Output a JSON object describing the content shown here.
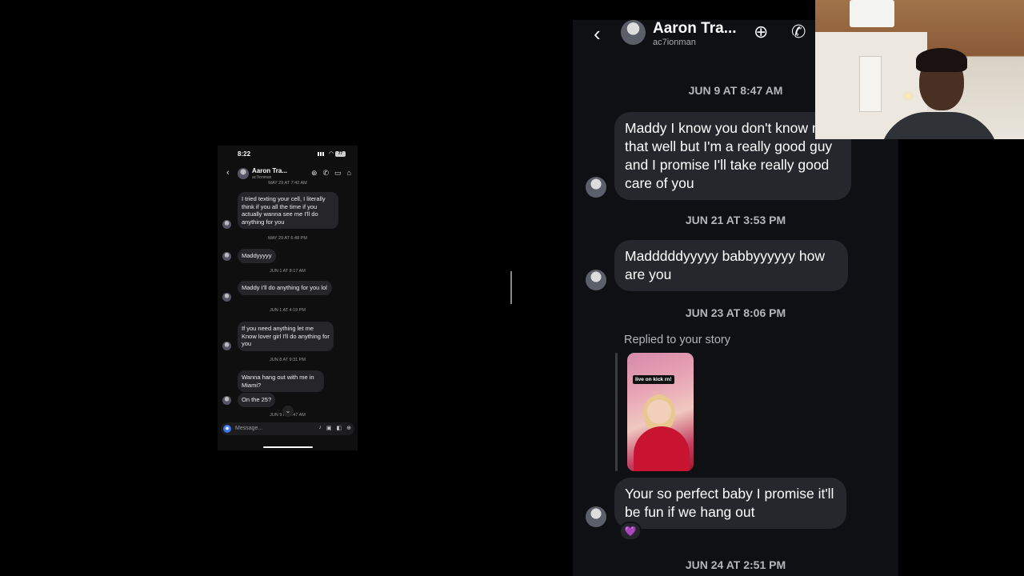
{
  "phone": {
    "status": {
      "time": "8:22",
      "battery": "77"
    },
    "header": {
      "name": "Aaron Tra...",
      "handle": "ac7ionman"
    },
    "dates": [
      "MAY 29 AT 7:42 AM",
      "MAY 29 AT 6:48 PM",
      "JUN 1 AT 8:17 AM",
      "JUN 1 AT 4:19 PM",
      "JUN 8 AT 9:31 PM",
      "JUN 9 AT 8:47 AM"
    ],
    "messages": [
      "I tried texting your cell, I literally think if you all the time if you actually wanna see me I'll do anything for you",
      "Maddyyyyy",
      "Maddy I'll do anything for you lol",
      "If you need anything let me Know lover girl I'll do anything for you",
      "Wanna hang out with me in Miami?",
      "On the 25?"
    ],
    "input_placeholder": "Message..."
  },
  "chat": {
    "header": {
      "name": "Aaron Tra...",
      "handle": "ac7ionman"
    },
    "dates": [
      "JUN 9 AT 8:47 AM",
      "JUN 21 AT 3:53 PM",
      "JUN 23 AT 8:06 PM",
      "JUN 24 AT 2:51 PM"
    ],
    "messages": [
      "Maddy I know you don't know me that well but I'm a really good guy and I promise I'll take really good care of you",
      "Madddddyyyyy babbyyyyyy how are you",
      "Your so perfect baby I promise it'll be fun if we hang out"
    ],
    "replied_label": "Replied to your story",
    "story_tag": "live on kick rn!",
    "reaction": "💜"
  },
  "icons": [
    "back-icon",
    "add-user-icon",
    "phone-icon",
    "video-icon",
    "tag-icon",
    "link-icon",
    "camera-icon",
    "mic-icon",
    "image-icon",
    "sticker-icon",
    "plus-icon",
    "chevron-down-icon"
  ],
  "colors": {
    "accent": "#3a74e8",
    "bubble": "#26272c",
    "background": "#0f1013",
    "reaction": "#a855f7"
  }
}
